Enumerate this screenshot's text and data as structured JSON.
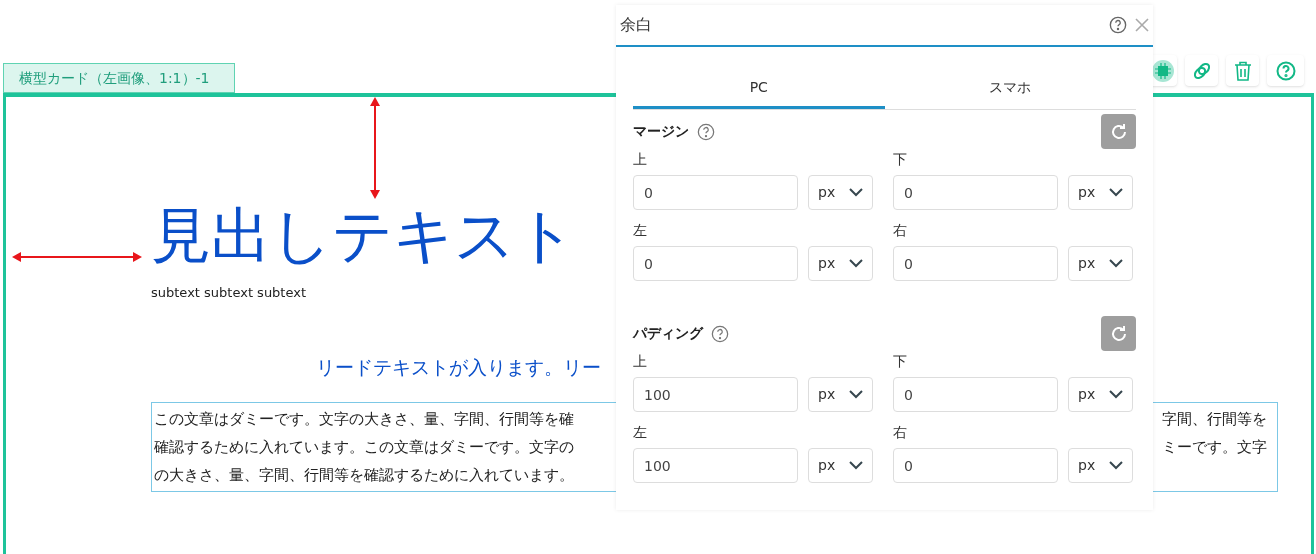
{
  "card_tag": "横型カード（左画像、1:1）-1",
  "preview": {
    "heading": "見出しテキスト",
    "subtext": "subtext subtext subtext",
    "lead": "リードテキストが入ります。リー",
    "body_lines": [
      {
        "left": "この文章はダミーです。文字の大きさ、量、字間、行間等を確",
        "right": "字間、行間等を"
      },
      {
        "left": "確認するために入れています。この文章はダミーです。文字の",
        "right": "ミーです。文字"
      },
      {
        "left": "の大きさ、量、字間、行間等を確認するために入れています。"
      }
    ]
  },
  "panel": {
    "title": "余白",
    "tabs": [
      {
        "label": "PC",
        "selected": true
      },
      {
        "label": "スマホ",
        "selected": false
      }
    ],
    "sections": [
      {
        "title": "マージン",
        "fields": [
          {
            "label": "上",
            "value": "0",
            "unit": "px"
          },
          {
            "label": "下",
            "value": "0",
            "unit": "px"
          },
          {
            "label": "左",
            "value": "0",
            "unit": "px"
          },
          {
            "label": "右",
            "value": "0",
            "unit": "px"
          }
        ]
      },
      {
        "title": "パディング",
        "fields": [
          {
            "label": "上",
            "value": "100",
            "unit": "px"
          },
          {
            "label": "下",
            "value": "0",
            "unit": "px"
          },
          {
            "label": "左",
            "value": "100",
            "unit": "px"
          },
          {
            "label": "右",
            "value": "0",
            "unit": "px"
          }
        ]
      }
    ]
  }
}
